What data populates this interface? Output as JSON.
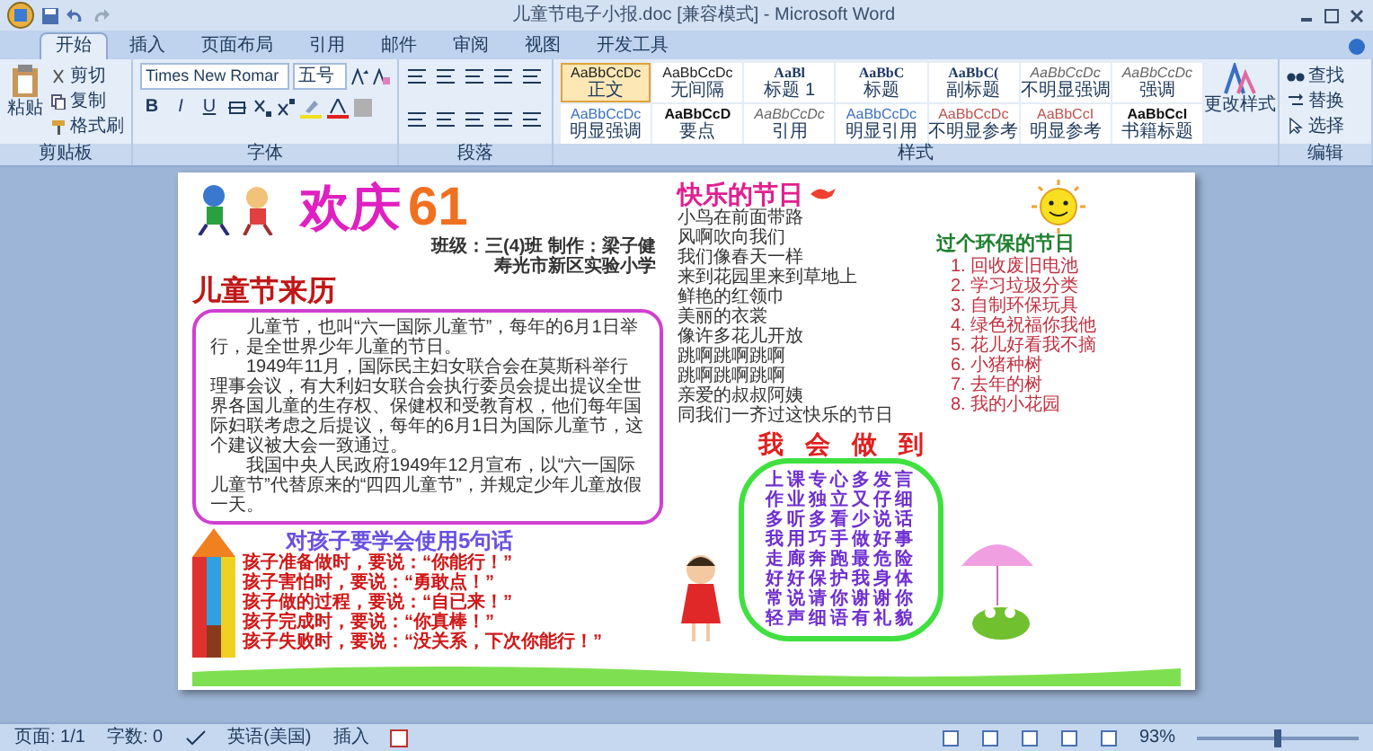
{
  "window": {
    "title": "儿童节电子小报.doc [兼容模式] - Microsoft Word"
  },
  "tabs": [
    {
      "label": "开始",
      "selected": true
    },
    {
      "label": "插入",
      "selected": false
    },
    {
      "label": "页面布局",
      "selected": false
    },
    {
      "label": "引用",
      "selected": false
    },
    {
      "label": "邮件",
      "selected": false
    },
    {
      "label": "审阅",
      "selected": false
    },
    {
      "label": "视图",
      "selected": false
    },
    {
      "label": "开发工具",
      "selected": false
    }
  ],
  "clipboard": {
    "paste": "粘贴",
    "cut": "剪切",
    "copy": "复制",
    "format_painter": "格式刷",
    "label": "剪贴板"
  },
  "font": {
    "name": "Times New Romar",
    "size": "五号",
    "format_buttons": [
      "B",
      "I",
      "U"
    ],
    "label": "字体"
  },
  "paragraph": {
    "label": "段落"
  },
  "styles": {
    "label": "样式",
    "change_styles": "更改样式",
    "items": [
      {
        "sample": "AaBbCcDc",
        "label": "正文",
        "selected": true,
        "kind": "plain"
      },
      {
        "sample": "AaBbCcDc",
        "label": "无间隔",
        "selected": false,
        "kind": "plain"
      },
      {
        "sample": "AaBl",
        "label": "标题 1",
        "selected": false,
        "kind": "heading"
      },
      {
        "sample": "AaBbC",
        "label": "标题",
        "selected": false,
        "kind": "heading"
      },
      {
        "sample": "AaBbC(",
        "label": "副标题",
        "selected": false,
        "kind": "heading"
      },
      {
        "sample": "AaBbCcDc",
        "label": "不明显强调",
        "selected": false,
        "kind": "subtle"
      },
      {
        "sample": "AaBbCcDc",
        "label": "强调",
        "selected": false,
        "kind": "subtle"
      },
      {
        "sample": "AaBbCcDc",
        "label": "明显强调",
        "selected": false,
        "kind": "blue"
      },
      {
        "sample": "AaBbCcD",
        "label": "要点",
        "selected": false,
        "kind": "strong"
      },
      {
        "sample": "AaBbCcDc",
        "label": "引用",
        "selected": false,
        "kind": "subtle"
      },
      {
        "sample": "AaBbCcDc",
        "label": "明显引用",
        "selected": false,
        "kind": "blue"
      },
      {
        "sample": "AaBbCcDc",
        "label": "不明显参考",
        "selected": false,
        "kind": "red"
      },
      {
        "sample": "AaBbCcI",
        "label": "明显参考",
        "selected": false,
        "kind": "red"
      },
      {
        "sample": "AaBbCcI",
        "label": "书籍标题",
        "selected": false,
        "kind": "strong"
      }
    ]
  },
  "editing": {
    "find": "查找",
    "replace": "替换",
    "select": "选择",
    "label": "编辑"
  },
  "poster": {
    "title_words": "欢庆",
    "title_number": "61",
    "class_info": [
      "班级：三(4)班 制作：梁子健",
      "寿光市新区实验小学"
    ],
    "history": {
      "heading": "儿童节来历",
      "paragraphs": [
        "儿童节，也叫“六一国际儿童节”，每年的6月1日举行，是全世界少年儿童的节日。",
        "1949年11月，国际民主妇女联合会在莫斯科举行理事会议，有大利妇女联合会执行委员会提出提议全世界各国儿童的生存权、保健权和受教育权，他们每年国际妇联考虑之后提议，每年的6月1日为国际儿童节，这个建议被大会一致通过。",
        "我国中央人民政府1949年12月宣布，以“六一国际儿童节”代替原来的“四四儿童节”，并规定少年儿童放假一天。"
      ]
    },
    "sentences": {
      "heading": "对孩子要学会使用5句话",
      "lines": [
        "孩子准备做时，要说：“你能行！”",
        "孩子害怕时，要说：“勇敢点！”",
        "孩子做的过程，要说：“自已来！”",
        "孩子完成时，要说：“你真棒！”",
        "孩子失败时，要说：“没关系，下次你能行！”"
      ]
    },
    "poem": {
      "heading": "快乐的节日",
      "lines": [
        "小鸟在前面带路",
        "风啊吹向我们",
        "我们像春天一样",
        "来到花园里来到草地上",
        "鲜艳的红领巾",
        "美丽的衣裳",
        "像许多花儿开放",
        "跳啊跳啊跳啊",
        "跳啊跳啊跳啊",
        "亲爱的叔叔阿姨",
        "同我们一齐过这快乐的节日"
      ]
    },
    "green": {
      "heading": "过个环保的节日",
      "items": [
        "1. 回收废旧电池",
        "2. 学习垃圾分类",
        "3. 自制环保玩具",
        "4. 绿色祝福你我他",
        "5. 花儿好看我不摘",
        "6. 小猪种树",
        "7. 去年的树",
        "8. 我的小花园"
      ]
    },
    "pledge": {
      "heading": [
        "我",
        "会",
        "做",
        "到"
      ],
      "rows": [
        "上课专心多发言",
        "作业独立又仔细",
        "多听多看少说话",
        "我用巧手做好事",
        "走廊奔跑最危险",
        "好好保护我身体",
        "常说请你谢谢你",
        "轻声细语有礼貌"
      ]
    }
  },
  "status_bar": {
    "page": "页面: 1/1",
    "words": "字数: 0",
    "language": "英语(美国)",
    "mode": "插入",
    "zoom": "93%",
    "zoom_slider": {
      "level": 0.5
    }
  }
}
